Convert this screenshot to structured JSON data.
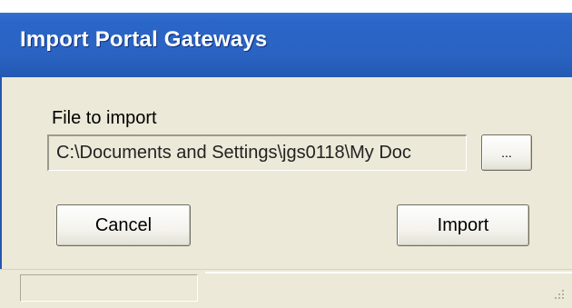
{
  "window": {
    "title": "Import Portal Gateways"
  },
  "form": {
    "file_label": "File to import",
    "file_value": "C:\\Documents and Settings\\jgs0118\\My Doc",
    "browse_label": "..."
  },
  "buttons": {
    "cancel_label": "Cancel",
    "import_label": "Import"
  },
  "statusbar": {
    "text": ""
  },
  "icons": {
    "resize_grip": "resize-grip-icon"
  }
}
